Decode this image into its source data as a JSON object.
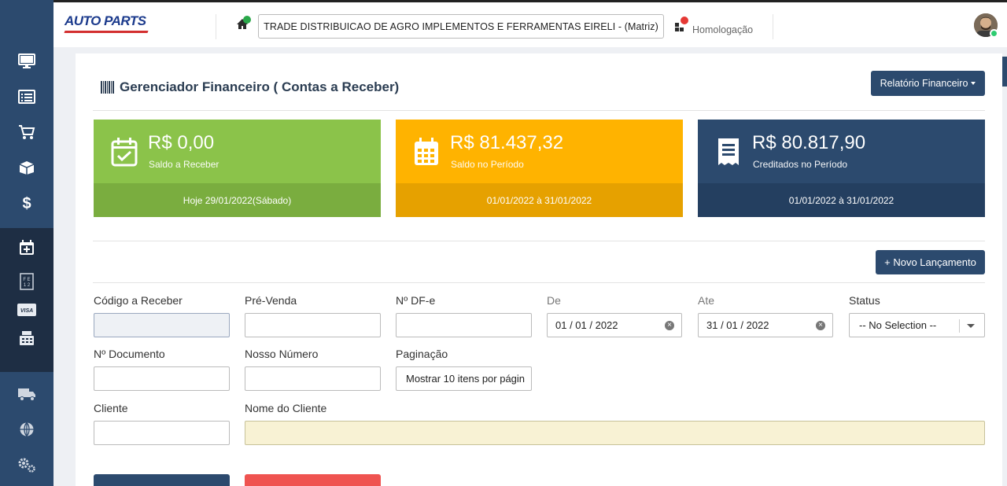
{
  "header": {
    "logo_text": "AUTO PARTS",
    "company": "TRADE DISTRIBUICAO DE AGRO IMPLEMENTOS E FERRAMENTAS EIRELI - (Matriz)",
    "environment": "Homologação"
  },
  "page": {
    "title": "Gerenciador Financeiro ( Contas a Receber)",
    "report_button": "Relatório Financeiro",
    "new_entry_button": "+ Novo Lançamento"
  },
  "cards": [
    {
      "amount": "R$ 0,00",
      "label": "Saldo a Receber",
      "footer": "Hoje 29/01/2022(Sábado)",
      "color": "#8bc34a",
      "footer_color": "#7aad3f"
    },
    {
      "amount": "R$ 81.437,32",
      "label": "Saldo no Período",
      "footer": "01/01/2022 à 31/01/2022",
      "color": "#ffb300",
      "footer_color": "#e6a100"
    },
    {
      "amount": "R$ 80.817,90",
      "label": "Creditados no Período",
      "footer": "01/01/2022 à 31/01/2022",
      "color": "#2c4a6e",
      "footer_color": "#243f60"
    }
  ],
  "form": {
    "codigo_label": "Código a Receber",
    "codigo_value": "",
    "prevenda_label": "Pré-Venda",
    "prevenda_value": "",
    "dfe_label": "Nº DF-e",
    "dfe_value": "",
    "de_label": "De",
    "de_value": "01 / 01 / 2022",
    "ate_label": "Ate",
    "ate_value": "31 / 01 / 2022",
    "status_label": "Status",
    "status_value": "-- No Selection --",
    "documento_label": "Nº Documento",
    "documento_value": "",
    "nosso_label": "Nosso Número",
    "nosso_value": "",
    "paginacao_label": "Paginação",
    "paginacao_value": "Mostrar 10 itens por págin",
    "cliente_label": "Cliente",
    "cliente_value": "",
    "nome_cliente_label": "Nome do Cliente",
    "nome_cliente_value": ""
  },
  "colors": {
    "sidebar": "#2c4a6e",
    "primary": "#2c4a6e",
    "danger": "#ef5350",
    "online": "#2ecc71"
  },
  "icons": [
    "monitor-icon",
    "list-icon",
    "cart-icon",
    "box-icon",
    "dollar-icon",
    "calendar-plus-icon",
    "nfe-icon",
    "visa-icon",
    "cash-register-icon",
    "truck-icon",
    "globe-icon",
    "gears-icon",
    "home-icon",
    "grid-icon",
    "barcode-icon",
    "calendar-check-icon",
    "calendar-icon",
    "receipt-icon"
  ]
}
